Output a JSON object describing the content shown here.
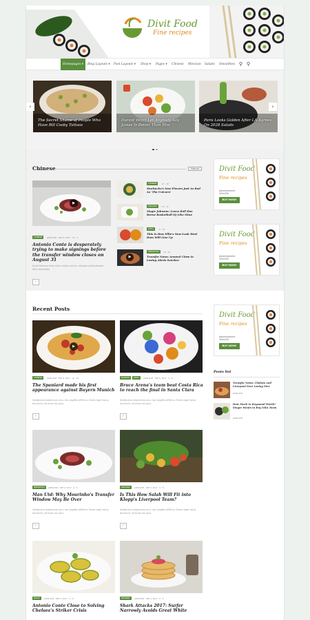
{
  "header": {
    "logo_title": "Divit Food",
    "logo_sub": "Fine recipes"
  },
  "nav": {
    "items": [
      "Homepages",
      "Blog Layouts",
      "Post Layouts",
      "Shop",
      "Pages",
      "Chinese",
      "Mexican",
      "Salads",
      "Smoothies"
    ],
    "active": "Homepages"
  },
  "slider": {
    "slides": [
      "The Secret Shame of People Who Have Bill Cosby Tattoos",
      "Durant Won't Let Anybody Say James Is Better Than Him",
      "Paris Looks Golden After LA Agrees On 2028 Salads"
    ]
  },
  "chinese": {
    "title": "Chinese",
    "view_all": "View all",
    "main": {
      "tag": "CHINESE",
      "meta": "JOHN DOE · DEC 8, 2017 · 14 · 2",
      "title": "Antonio Conte is desperately trying to make signings before the transfer window closes on August 31",
      "excerpt": "Nulla tempus enim enim varius varius, aliquam pellentesque felis venenatis."
    },
    "side": [
      {
        "tag": "CHINESE",
        "meta": "27 · 18",
        "title": "Starbucks's New Flavors Just As Bad As 'The Unicorn'"
      },
      {
        "tag": "ORGANIC",
        "meta": "33 · 11",
        "title": "Magic Johnson: Lonzo Ball Has Borne Basketball IQ Like Mine"
      },
      {
        "tag": "GRILL",
        "meta": "8 · 19",
        "title": "This Is How Ellie's New-Look West Ham Will Line Up"
      },
      {
        "tag": "BREAKFAST",
        "meta": "76 · 20",
        "title": "Transfer News: Arsenal Close to Losing Alexis Sanchez"
      }
    ]
  },
  "recent": {
    "title": "Recent Posts",
    "posts": [
      {
        "tag": "CHINESE",
        "meta": "JOHN DOE · SEP 6, 2017 · 12 · 13",
        "title": "The Spaniard made his first appearance against Bayern Munich",
        "excerpt": "Vestibulum bibendum arcu nec sagittis efficitur. Etiam eget lacus tincidunt, ultricies dui quis."
      },
      {
        "tag": "BURGER",
        "tag2": "GRILL",
        "meta": "JOHN DOE · SEP 6, 2017 · 5 · 8",
        "title": "Bruce Arena's team beat Costa Rica to reach the final in Santa Clara",
        "excerpt": "Vestibulum bibendum arcu nec sagittis efficitur. Etiam eget lacus tincidunt, ultricies dui quis."
      },
      {
        "tag": "BREAKFAST",
        "meta": "JOHN DOE · SEP 4, 2017 · 4 · 5",
        "title": "Man Utd: Why Mourinho's Transfer Window May Be Over",
        "excerpt": "Vestibulum bibendum arcu nec sagittis efficitur. Etiam eget lacus tincidunt, ultricies dui quis."
      },
      {
        "tag": "ORGANIC",
        "meta": "JOHN DOE · SEP 4, 2017 · 2 · 8",
        "title": "Is This How Salah Will Fit into Klopp's Liverpool Team?",
        "excerpt": "Vestibulum bibendum arcu nec sagittis efficitur. Etiam eget lacus tincidunt, ultricies dui quis."
      },
      {
        "tag": "PASTA",
        "meta": "JOHN DOE · SEP 4, 2017 · 3 · 6",
        "title": "Antonio Conte Close to Solving Chelsea's Striker Crisis",
        "excerpt": ""
      },
      {
        "tag": "DESSERT",
        "meta": "JOHN DOE · SEP 4, 2017 · 5 · 4",
        "title": "Shark Attacks 2017: Surfer Narrowly Avoids Great White",
        "excerpt": ""
      }
    ]
  },
  "ad": {
    "title": "Divit Food",
    "sub": "Fine recipes",
    "label1": "Advertisement",
    "label2": "300x250",
    "button": "BUY NOW!"
  },
  "posts_list": {
    "title": "Posts list",
    "items": [
      {
        "title": "Transfer News: Chelsea and Liverpool Face Losing Star",
        "meta": "JOHN DOE"
      },
      {
        "title": "How Much Is Raymond Worth? Singer Wants to Buy NBA Team",
        "meta": "JOHN DOE"
      }
    ]
  },
  "colors": {
    "accent": "#5b8e3e",
    "orange": "#e08a1a"
  }
}
